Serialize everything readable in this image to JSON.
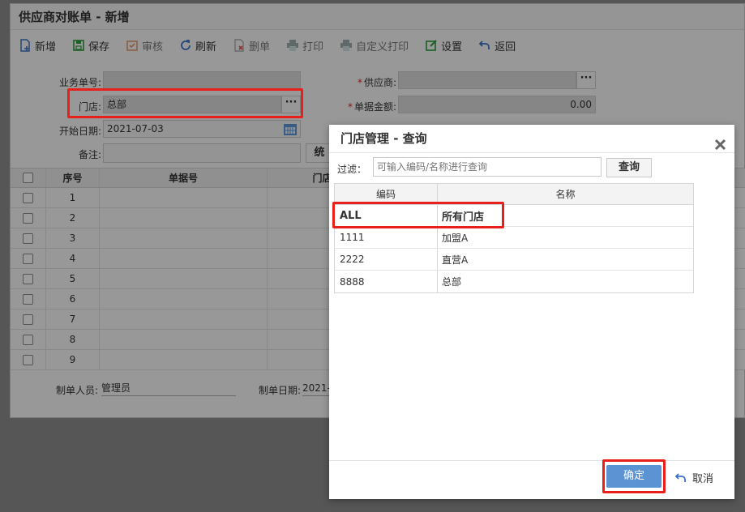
{
  "window": {
    "title": "供应商对账单 - 新增"
  },
  "toolbar": {
    "new": "新增",
    "save": "保存",
    "audit": "审核",
    "refresh": "刷新",
    "delete": "删单",
    "print": "打印",
    "custom_print": "自定义打印",
    "settings": "设置",
    "back": "返回"
  },
  "form": {
    "doc_no_label": "业务单号:",
    "store_label": "门店:",
    "store_value": "总部",
    "start_date_label": "开始日期:",
    "start_date_value": "2021-07-03",
    "note_label": "备注:",
    "supplier_label": "供应商:",
    "amount_label": "单据金额:",
    "amount_value": "0.00",
    "partial_button": "统"
  },
  "grid": {
    "headers": {
      "seq": "序号",
      "doc_no": "单据号",
      "store_code": "门店编码"
    },
    "rows": [
      "1",
      "2",
      "3",
      "4",
      "5",
      "6",
      "7",
      "8",
      "9"
    ]
  },
  "footer": {
    "creator_label": "制单人员:",
    "creator_value": "管理员",
    "date_label": "制单日期:",
    "date_value": "2021-"
  },
  "dialog": {
    "title": "门店管理 - 查询",
    "filter_label": "过滤：",
    "filter_placeholder": "可输入编码/名称进行查询",
    "query_button": "查询",
    "headers": {
      "code": "编码",
      "name": "名称"
    },
    "rows": [
      {
        "code": "ALL",
        "name": "所有门店"
      },
      {
        "code": "1111",
        "name": "加盟A"
      },
      {
        "code": "2222",
        "name": "直营A"
      },
      {
        "code": "8888",
        "name": "总部"
      }
    ],
    "ok_button": "确定",
    "cancel_button": "取消"
  },
  "colors": {
    "accent": "#5b93d3",
    "highlight": "#e8201c",
    "required": "#d22222"
  }
}
